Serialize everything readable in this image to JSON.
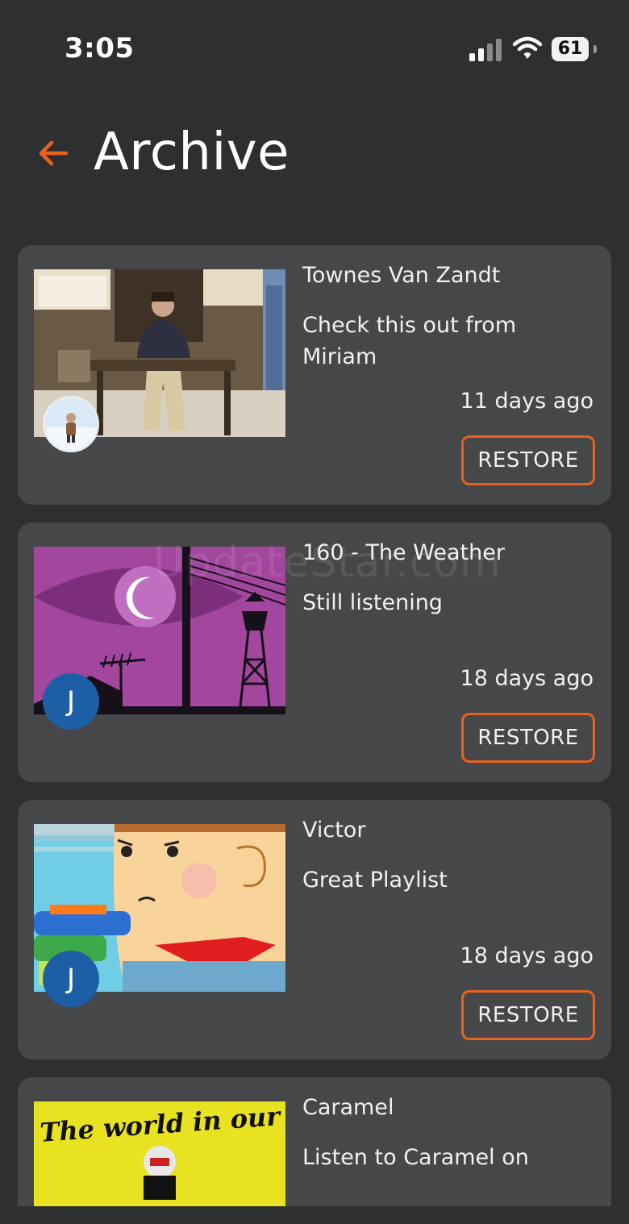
{
  "status_bar": {
    "time": "3:05",
    "battery": "61",
    "icons": [
      "signal-icon",
      "wifi-icon",
      "battery-icon"
    ]
  },
  "header": {
    "back_icon": "arrow-left-icon",
    "title": "Archive"
  },
  "accent_color": "#e8621f",
  "archive_items": [
    {
      "title": "Townes Van Zandt",
      "message": "Check this out from Miriam",
      "time": "11 days ago",
      "restore_label": "RESTORE",
      "avatar_type": "photo"
    },
    {
      "title": "160 - The Weather",
      "message": "Still listening",
      "time": "18 days ago",
      "restore_label": "RESTORE",
      "avatar_type": "letter",
      "avatar_letter": "J"
    },
    {
      "title": "Victor",
      "message": "Great Playlist",
      "time": "18 days ago",
      "restore_label": "RESTORE",
      "avatar_type": "letter",
      "avatar_letter": "J"
    },
    {
      "title": "Caramel",
      "message": "Listen to Caramel on",
      "cover_text": "The world in our own Backyard"
    }
  ],
  "watermark": "UpdateStar.com"
}
